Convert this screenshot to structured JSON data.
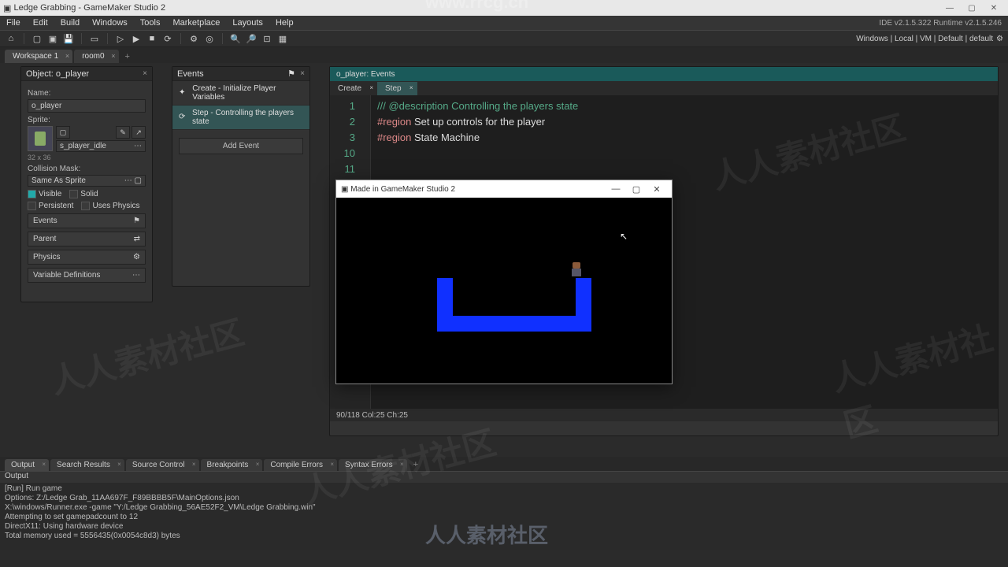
{
  "titlebar": {
    "title": "Ledge Grabbing - GameMaker Studio 2"
  },
  "menu": {
    "items": [
      "File",
      "Edit",
      "Build",
      "Windows",
      "Tools",
      "Marketplace",
      "Layouts",
      "Help"
    ],
    "right": "IDE v2.1.5.322 Runtime v2.1.5.246"
  },
  "status_right": "Windows | Local | VM | Default | default",
  "ws_tabs": [
    {
      "label": "Workspace 1",
      "active": true
    },
    {
      "label": "room0",
      "active": false
    }
  ],
  "object_panel": {
    "title": "Object: o_player",
    "name_label": "Name:",
    "name_value": "o_player",
    "sprite_label": "Sprite:",
    "sprite_name": "s_player_idle",
    "sprite_dim": "32 x 36",
    "collision_label": "Collision Mask:",
    "collision_value": "Same As Sprite",
    "checks": {
      "visible": "Visible",
      "solid": "Solid",
      "persistent": "Persistent",
      "uses_physics": "Uses Physics"
    },
    "sections": [
      "Events",
      "Parent",
      "Physics",
      "Variable Definitions"
    ]
  },
  "events_panel": {
    "title": "Events",
    "items": [
      {
        "label": "Create - Initialize Player Variables",
        "sel": false
      },
      {
        "label": "Step - Controlling the players state",
        "sel": true
      }
    ],
    "add": "Add Event"
  },
  "code_panel": {
    "title": "o_player: Events",
    "tabs": [
      {
        "label": "Create",
        "active": false
      },
      {
        "label": "Step",
        "active": true
      }
    ],
    "lines": [
      {
        "n": "1",
        "seg": [
          {
            "c": "c-gr",
            "t": "/// @description Controlling the players state"
          }
        ]
      },
      {
        "n": "2",
        "seg": [
          {
            "c": "c-wh",
            "t": ""
          }
        ]
      },
      {
        "n": "3",
        "seg": [
          {
            "c": "c-or",
            "t": "#region"
          },
          {
            "c": "c-wh",
            "t": " Set up controls for the player"
          }
        ]
      },
      {
        "n": "10",
        "seg": [
          {
            "c": "c-wh",
            "t": ""
          }
        ]
      },
      {
        "n": "11",
        "seg": [
          {
            "c": "c-or",
            "t": "#region"
          },
          {
            "c": "c-wh",
            "t": " State Machine"
          }
        ]
      }
    ],
    "status": "90/118 Col:25 Ch:25"
  },
  "game_window": {
    "title": "Made in GameMaker Studio 2"
  },
  "bottom_tabs": [
    "Output",
    "Search Results",
    "Source Control",
    "Breakpoints",
    "Compile Errors",
    "Syntax Errors"
  ],
  "output": {
    "header": "Output",
    "lines": [
      "[Run] Run game",
      "Options: Z:/Ledge Grab_11AA697F_F89BBBB5F\\MainOptions.json",
      "X:\\windows/Runner.exe  -game \"Y:/Ledge Grabbing_56AE52F2_VM\\Ledge Grabbing.win\"",
      "Attempting to set gamepadcount to 12",
      "DirectX11: Using hardware device",
      "Total memory used = 5556435(0x0054c8d3) bytes"
    ]
  },
  "watermarks": {
    "url": "www.rrcg.cn",
    "cn": "人人素材社区"
  }
}
